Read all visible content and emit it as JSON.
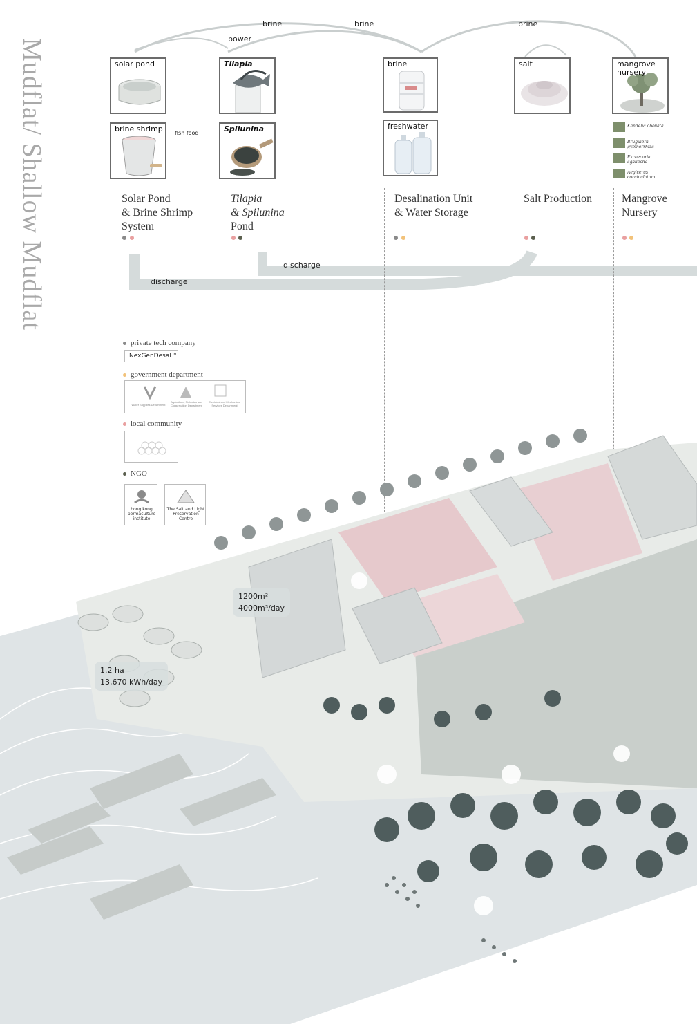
{
  "title": "Mudflat/ Shallow Mudflat",
  "flows": {
    "brine_1": "brine",
    "brine_2": "brine",
    "brine_3": "brine",
    "power": "power",
    "fish_food": "fish food",
    "discharge_1": "discharge",
    "discharge_2": "discharge"
  },
  "cards": {
    "solar_pond": "solar pond",
    "tilapia": "Tilapia",
    "brine": "brine",
    "salt": "salt",
    "mangrove_nursery": "mangrove nursery",
    "brine_shrimp": "brine shrimp",
    "spilunina": "Spilunina",
    "freshwater": "freshwater"
  },
  "mangrove_species": [
    "Kandelia obovata",
    "Bruguiera gymnorrhiza",
    "Excoecaria agallocha",
    "Aegiceras corniculatum"
  ],
  "columns": [
    {
      "line1": "Solar Pond",
      "line2": "& Brine Shrimp",
      "line3": "System"
    },
    {
      "line1": "Tilapia",
      "line2": "& Spilunina",
      "line3": "Pond"
    },
    {
      "line1": "Desalination Unit",
      "line2": "& Water Storage",
      "line3": ""
    },
    {
      "line1": "Salt Production",
      "line2": "",
      "line3": ""
    },
    {
      "line1": "Mangrove",
      "line2": "Nursery",
      "line3": ""
    }
  ],
  "legend": {
    "private": "private tech company",
    "private_logo": "NexGenDesal™",
    "government": "government department",
    "gov_logo_1": "Water Supplies Department",
    "gov_logo_2": "Agriculture, Fisheries and Conservation Department",
    "gov_logo_3": "Electrical and Mechanical Services Department",
    "community": "local community",
    "ngo": "NGO",
    "ngo_1": "hong kong permaculture institute",
    "ngo_2": "The Salt and Light Preservation Centre"
  },
  "stats": {
    "desal_area": "1200m²",
    "desal_rate": "4000m³/day",
    "solar_area": "1.2 ha",
    "solar_energy": "13,670 kWh/day"
  },
  "colors": {
    "private": "#8a8a8a",
    "government": "#f2c27a",
    "community": "#e9a0a0",
    "ngo": "#5b5f4e",
    "salt_pink": "#e6c9cc",
    "water": "#dfe4e6",
    "tree": "#4f5d5d"
  }
}
